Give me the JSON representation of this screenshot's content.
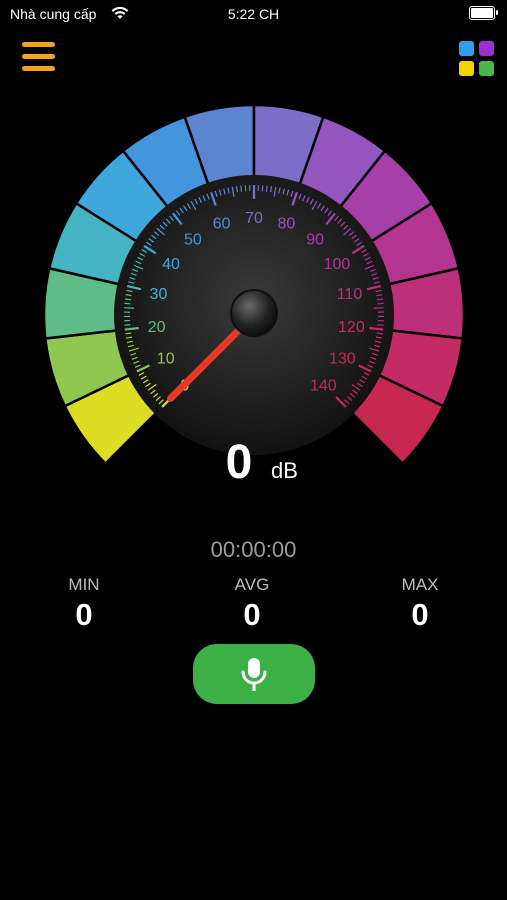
{
  "status_bar": {
    "carrier": "Nhà cung cấp",
    "time": "5:22 CH"
  },
  "colors": {
    "menu": "#f7a21b",
    "record": "#3cb045",
    "apps": [
      "#2f9ff0",
      "#9b2fcf",
      "#f3d400",
      "#47b847"
    ],
    "gauge_segments": [
      "#dcdc22",
      "#90c751",
      "#5fbb87",
      "#45b4c2",
      "#3ea7db",
      "#4396db",
      "#5c84d0",
      "#7c6ec8",
      "#9455be",
      "#a73fa8",
      "#b3358f",
      "#bb3079",
      "#c42b65",
      "#c82752"
    ]
  },
  "icons": {
    "menu": "hamburger-icon",
    "apps": "apps-grid-icon",
    "record": "microphone-icon",
    "wifi": "wifi-icon",
    "battery": "battery-icon"
  },
  "gauge": {
    "value": 0,
    "unit": "dB",
    "min": 0,
    "max": 140,
    "tick_labels": [
      "0",
      "10",
      "20",
      "30",
      "40",
      "50",
      "60",
      "70",
      "80",
      "90",
      "100",
      "110",
      "120",
      "130",
      "140"
    ]
  },
  "timer": "00:00:00",
  "stats": {
    "min": {
      "label": "MIN",
      "value": "0"
    },
    "avg": {
      "label": "AVG",
      "value": "0"
    },
    "max": {
      "label": "MAX",
      "value": "0"
    }
  }
}
